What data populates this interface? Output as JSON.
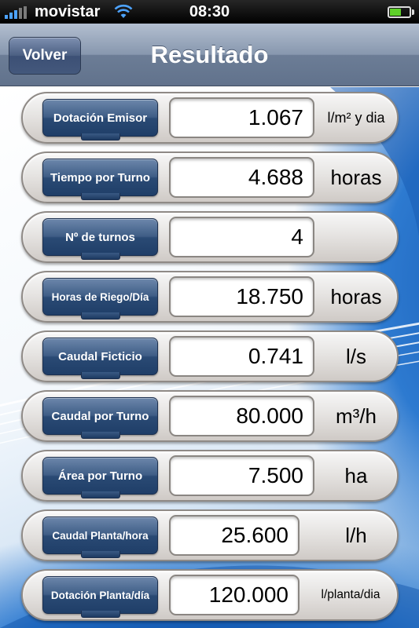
{
  "status_bar": {
    "carrier": "movistar",
    "time": "08:30",
    "signal_icon": "signal-bars-icon",
    "wifi_icon": "wifi-icon",
    "battery_icon": "battery-icon",
    "battery_level": 0.6
  },
  "navbar": {
    "back_label": "Volver",
    "title": "Resultado"
  },
  "colors": {
    "nav_bar": "#7d8ca3",
    "label_button": "#2a4a74",
    "battery": "#5fd12a",
    "signal": "#4da3ff"
  },
  "results": [
    {
      "label": "Dotación Emisor",
      "value": "1.067",
      "unit": "l/m² y dia"
    },
    {
      "label": "Tiempo por Turno",
      "value": "4.688",
      "unit": "horas"
    },
    {
      "label": "Nº de turnos",
      "value": "4",
      "unit": ""
    },
    {
      "label": "Horas de Riego/Día",
      "value": "18.750",
      "unit": "horas"
    },
    {
      "label": "Caudal Ficticio",
      "value": "0.741",
      "unit": "l/s"
    },
    {
      "label": "Caudal por Turno",
      "value": "80.000",
      "unit": "m³/h"
    },
    {
      "label": "Área por Turno",
      "value": "7.500",
      "unit": "ha"
    },
    {
      "label": "Caudal Planta/hora",
      "value": "25.600",
      "unit": "l/h"
    },
    {
      "label": "Dotación Planta/día",
      "value": "120.000",
      "unit": "l/planta/dia"
    }
  ]
}
